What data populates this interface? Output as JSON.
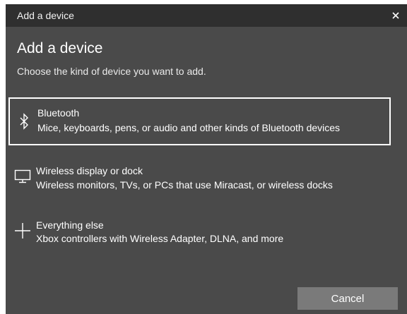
{
  "window": {
    "title": "Add a device",
    "close_glyph": "×"
  },
  "main": {
    "heading": "Add a device",
    "subheading": "Choose the kind of device you want to add."
  },
  "options": [
    {
      "title": "Bluetooth",
      "description": "Mice, keyboards, pens, or audio and other kinds of Bluetooth devices",
      "icon": "bluetooth-icon",
      "selected": true
    },
    {
      "title": "Wireless display or dock",
      "description": "Wireless monitors, TVs, or PCs that use Miracast, or wireless docks",
      "icon": "monitor-icon",
      "selected": false
    },
    {
      "title": "Everything else",
      "description": "Xbox controllers with Wireless Adapter, DLNA, and more",
      "icon": "plus-icon",
      "selected": false
    }
  ],
  "footer": {
    "cancel_label": "Cancel"
  },
  "colors": {
    "background": "#4a4a4a",
    "titlebar": "#2f2f2f",
    "button": "#7a7a7a",
    "text": "#ffffff"
  }
}
